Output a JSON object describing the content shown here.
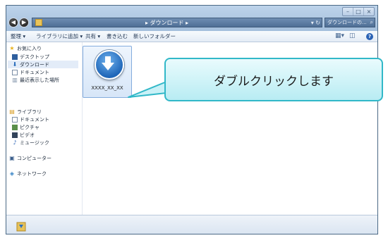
{
  "window": {
    "title_controls": [
      "–",
      "□",
      "×"
    ],
    "address": {
      "path_text": "▸ ダウンロード ▸",
      "dropdown_glyph": "▾ ↻"
    },
    "search_placeholder": "ダウンロードの..."
  },
  "toolbar": {
    "organize": "整理 ▾",
    "add_to_library": "ライブラリに追加 ▾",
    "share": "共有 ▾",
    "burn": "書き込む",
    "new_folder": "新しいフォルダー",
    "help": "?"
  },
  "nav": {
    "favorites": {
      "header": "お気に入り",
      "items": [
        "デスクトップ",
        "ダウンロード",
        "ドキュメント",
        "最近表示した場所"
      ]
    },
    "libraries": {
      "header": "ライブラリ",
      "items": [
        "ドキュメント",
        "ピクチャ",
        "ビデオ",
        "ミュージック"
      ]
    },
    "computer": "コンピューター",
    "network": "ネットワーク"
  },
  "content": {
    "files": [
      {
        "name": "XXXX_XX_XX",
        "icon": "download-arrow-icon"
      }
    ]
  },
  "callout": {
    "text": "ダブルクリックします"
  },
  "colors": {
    "callout_border": "#31b8c8",
    "callout_fill": "#c6f0f6",
    "icon_blue": "#1f66b8",
    "selection_border": "#84acdd"
  }
}
